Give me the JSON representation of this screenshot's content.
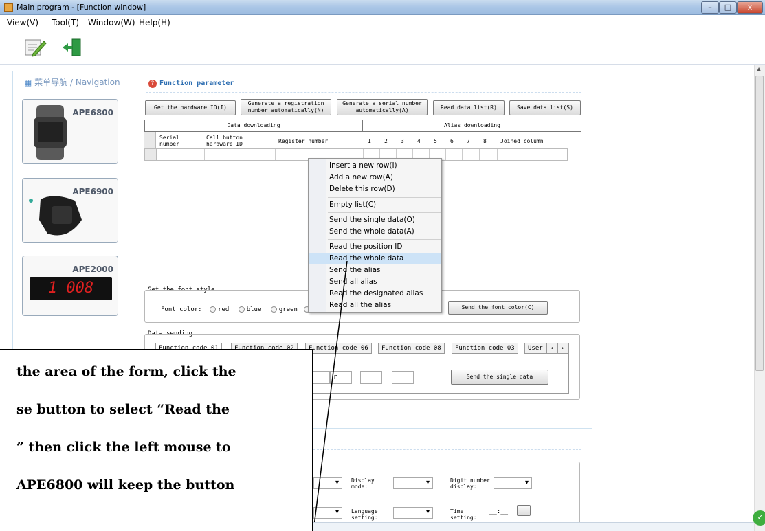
{
  "window": {
    "title": "Main program - [Function window]",
    "min": "–",
    "max": "□",
    "close": "x"
  },
  "menu": [
    "View(V)",
    "Tool(T)",
    "Window(W)",
    "Help(H)"
  ],
  "toolbar": {
    "edit_icon": "edit-icon",
    "exit_icon": "exit-door-icon"
  },
  "nav": {
    "title": "菜单导航 / Navigation",
    "products": [
      {
        "label": "APE6800",
        "type": "watch"
      },
      {
        "label": "APE6900",
        "type": "band"
      },
      {
        "label": "APE2000",
        "type": "display",
        "display_text": "1 008"
      }
    ]
  },
  "function": {
    "title": "Function parameter",
    "buttons": {
      "hardware": "Get the hardware ID(I)",
      "reg": "Generate a registration number automatically(N)",
      "serial": "Generate a serial number automatically(A)",
      "read": "Read data list(R)",
      "save": "Save data list(S)"
    },
    "sections": {
      "data": "Data downloading",
      "alias": "Alias downloading"
    },
    "columns": [
      "Serial number",
      "Call button hardware ID",
      "Register number",
      "1",
      "2",
      "3",
      "4",
      "5",
      "6",
      "7",
      "8",
      "Joined column"
    ]
  },
  "context_menu": [
    "Insert a new row(I)",
    "Add a new row(A)",
    "Delete this row(D)",
    "Empty list(C)",
    "Send the single data(O)",
    "Send the whole data(A)",
    "Read the position ID",
    "Read the whole data",
    "Send the alias",
    "Send all alias",
    "Read the designated alias",
    "Read all the alias"
  ],
  "font_style": {
    "legend": "Set the font style",
    "label": "Font color:",
    "options": [
      "red",
      "blue",
      "green"
    ],
    "send": "Send the font color(C)"
  },
  "sending": {
    "legend": "Data sending",
    "tabs": [
      "Function code 01",
      "Function code 02",
      "Function code 06",
      "Function code 08",
      "Function code 03",
      "User"
    ],
    "field_value": "r",
    "send": "Send the single data"
  },
  "lower": {
    "display_label": "Display mode:",
    "digit_label": "Digit number display:",
    "language_label": "Language setting:",
    "time_label": "Time setting:",
    "time_value": "__:__"
  },
  "callout": {
    "lines": [
      "the area of the form, click the",
      "se button to select “Read the",
      "” then click the left mouse to",
      "APE6800 will keep the button"
    ]
  },
  "colors": {
    "accent": "#2f6fb2",
    "panel_border": "#cfe2f0",
    "highlight": "#cde3f7",
    "red": "#e02020"
  }
}
